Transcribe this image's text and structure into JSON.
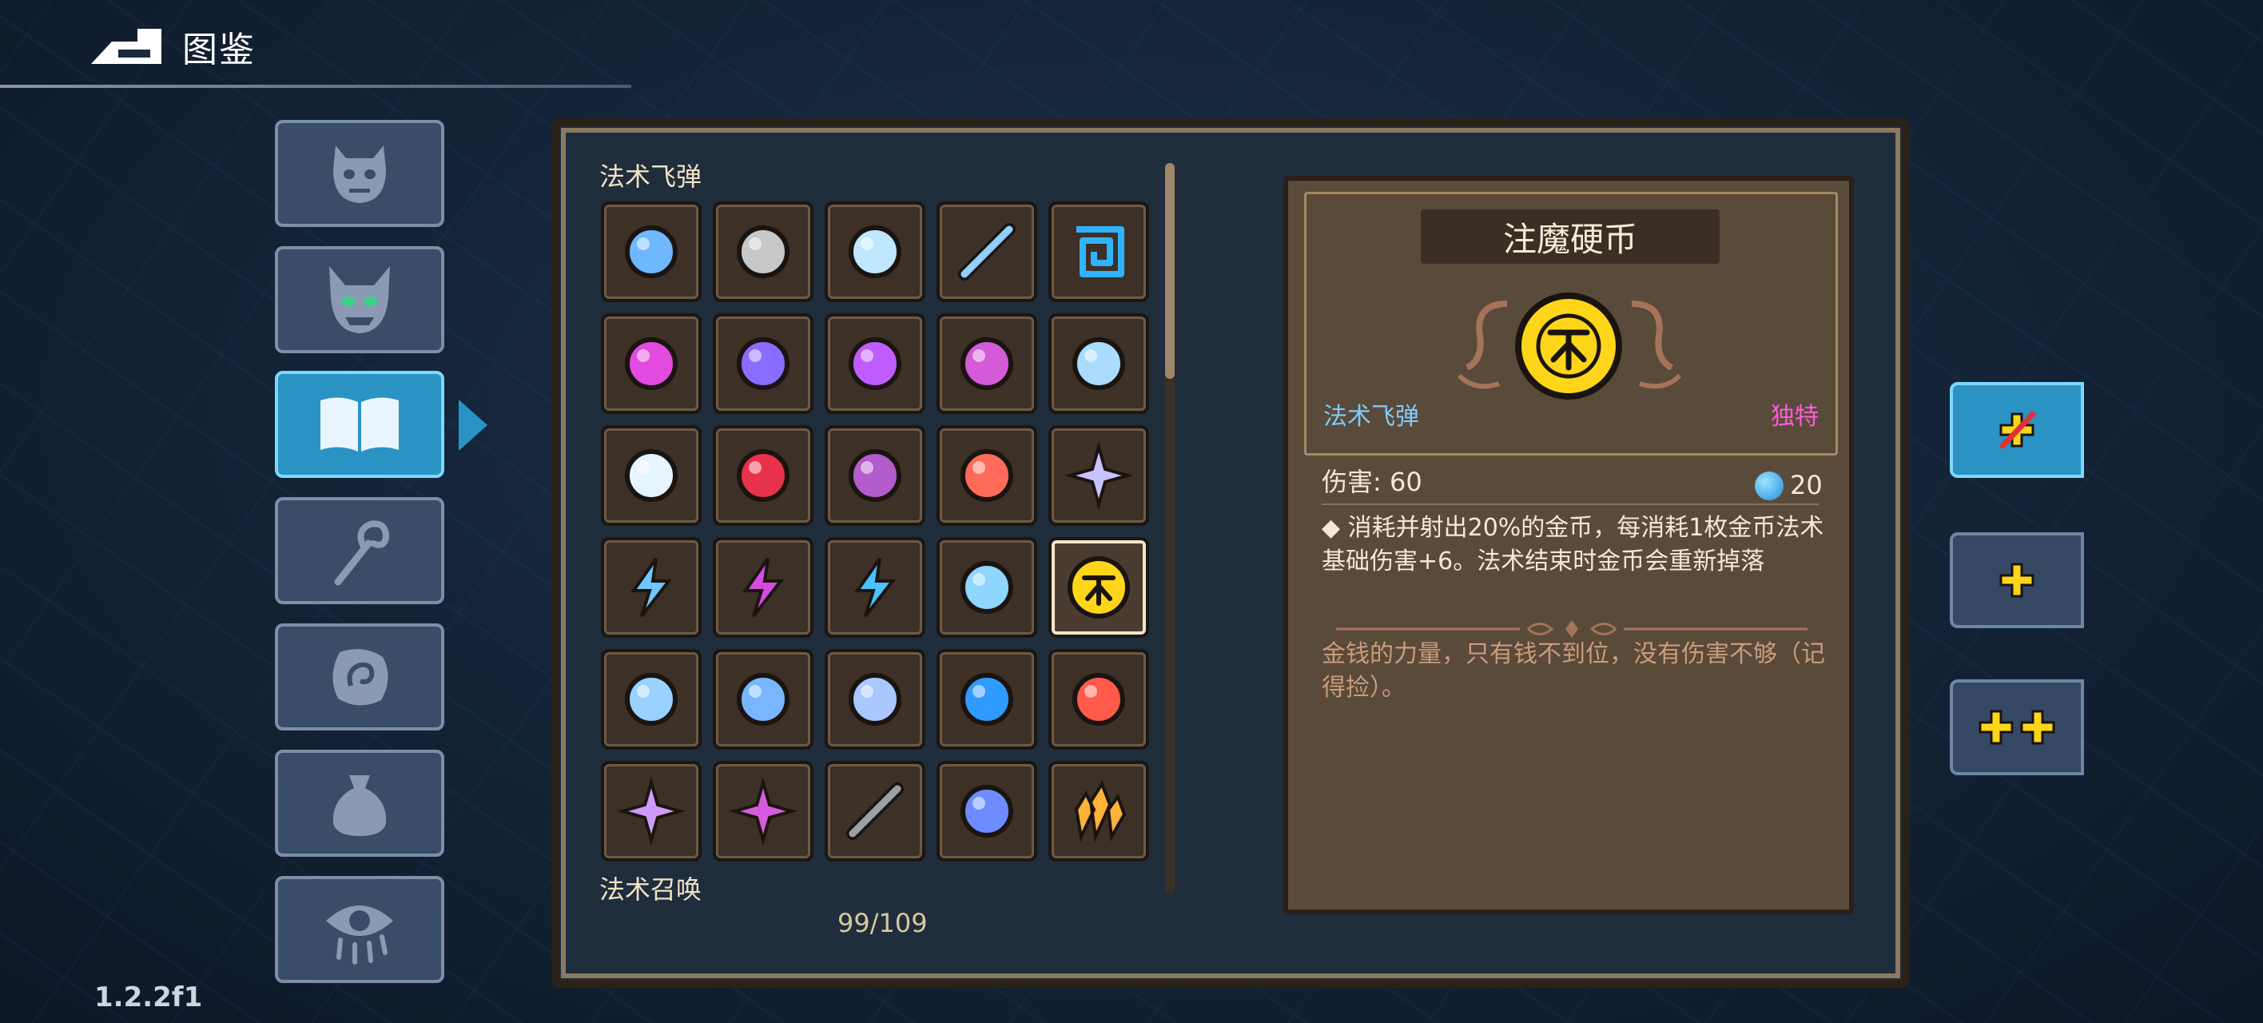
{
  "header": {
    "title": "图鉴"
  },
  "version": "1.2.2f1",
  "sidebar": {
    "items": [
      {
        "icon": "demon-face-icon"
      },
      {
        "icon": "horned-mask-icon"
      },
      {
        "icon": "open-book-icon",
        "active": true
      },
      {
        "icon": "magic-staff-icon"
      },
      {
        "icon": "rune-stone-icon"
      },
      {
        "icon": "pouch-icon"
      },
      {
        "icon": "eye-icon"
      }
    ]
  },
  "grid": {
    "section_label": "法术飞弹",
    "next_section_label": "法术召唤",
    "count": "99/109",
    "rows": [
      [
        "water-orb-icon",
        "rock-ball-icon",
        "butterfly-icon",
        "ice-spear-icon",
        "spiral-square-icon"
      ],
      [
        "purple-flame-icon",
        "vortex-orb-icon",
        "arcane-orb-icon",
        "twin-blade-icon",
        "serpent-head-icon"
      ],
      [
        "ice-comet-icon",
        "spiked-bomb-icon",
        "crystal-rock-icon",
        "rainbow-fan-icon",
        "four-star-icon"
      ],
      [
        "lightning-bolt-icon",
        "purple-lightning-icon",
        "thunder-circle-icon",
        "water-wave-icon",
        "coin-icon"
      ],
      [
        "ice-slash-icon",
        "wind-slash-icon",
        "sword-cross-icon",
        "water-blob-icon",
        "fire-burst-icon"
      ],
      [
        "star-shards-icon",
        "pentagram-icon",
        "arrow-icon",
        "meteor-ring-icon",
        "crystal-cluster-icon"
      ]
    ]
  },
  "detail": {
    "name": "注魔硬币",
    "type": "法术飞弹",
    "rarity": "独特",
    "damage": "伤害: 60",
    "mana": "20",
    "description": "◆ 消耗并射出20%的金币，每消耗1枚金币法术基础伤害+6。法术结束时金币会重新掉落",
    "flavor": "金钱的力量，只有钱不到位，没有伤害不够（记得捡）。"
  },
  "colors": {
    "accent": "#2a93c4",
    "rarity": "#ff5bd8",
    "type": "#7ecbff",
    "coin": "#ffd51a"
  }
}
